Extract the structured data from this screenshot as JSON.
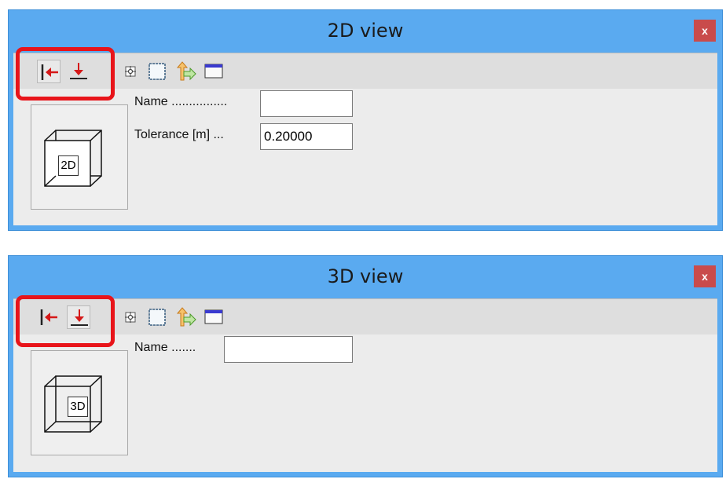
{
  "windows": [
    {
      "title": "2D view",
      "close_glyph": "x",
      "preview_label": "2D",
      "fields": [
        {
          "label": "Name ................",
          "value": ""
        },
        {
          "label": "Tolerance [m] ...",
          "value": "0.20000"
        }
      ]
    },
    {
      "title": "3D view",
      "close_glyph": "x",
      "preview_label": "3D",
      "fields": [
        {
          "label": "Name .......",
          "value": ""
        }
      ]
    }
  ],
  "toolbar_icons": [
    "arrow-left-to-bar-icon",
    "arrow-down-to-bar-icon",
    "snap-point-icon",
    "frame-icon",
    "export-arrow-icon",
    "window-icon"
  ],
  "colors": {
    "title_bar": "#5aaaf0",
    "highlight": "#e8141a",
    "close": "#c94b4b"
  }
}
